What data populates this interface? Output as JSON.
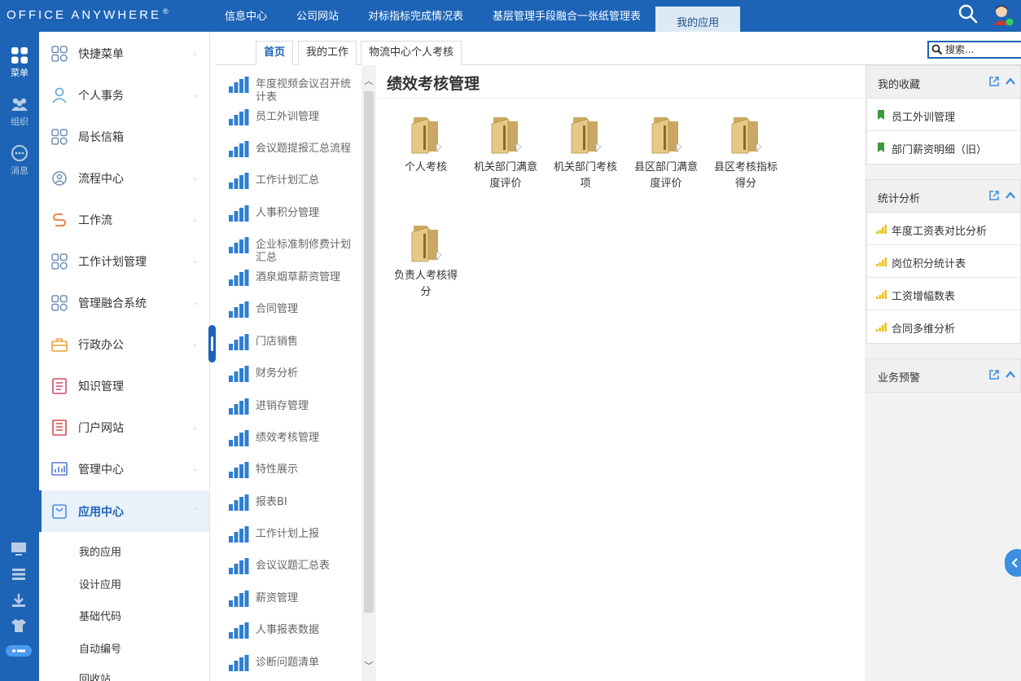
{
  "header": {
    "logo_text": "OFFICE ANYWHERE",
    "logo_mark": "®",
    "tabs": [
      {
        "label": "信息中心"
      },
      {
        "label": "公司网站"
      },
      {
        "label": "对标指标完成情况表"
      },
      {
        "label": "基层管理手段融合一张纸管理表"
      },
      {
        "label": "我的应用"
      }
    ],
    "active_tab": "我的应用",
    "search_icon": "search-icon",
    "avatar_icon": "user-avatar-icon"
  },
  "rail": {
    "items": [
      {
        "label": "菜单",
        "icon": "grid-icon"
      },
      {
        "label": "组织",
        "icon": "people-icon"
      },
      {
        "label": "消息",
        "icon": "chat-icon"
      }
    ],
    "bottom_icons": [
      "monitor-icon",
      "layers-icon",
      "download-icon",
      "shirt-icon",
      "toggle-icon"
    ]
  },
  "menu": {
    "items": [
      {
        "label": "快捷菜单",
        "icon": "apps-icon"
      },
      {
        "label": "个人事务",
        "icon": "person-icon"
      },
      {
        "label": "局长信箱",
        "icon": "apps-icon"
      },
      {
        "label": "流程中心",
        "icon": "flow-icon"
      },
      {
        "label": "工作流",
        "icon": "workflow-icon"
      },
      {
        "label": "工作计划管理",
        "icon": "apps-icon"
      },
      {
        "label": "管理融合系统",
        "icon": "apps-icon"
      },
      {
        "label": "行政办公",
        "icon": "briefcase-icon"
      },
      {
        "label": "知识管理",
        "icon": "book-icon"
      },
      {
        "label": "门户网站",
        "icon": "portal-icon"
      },
      {
        "label": "管理中心",
        "icon": "chart-icon"
      },
      {
        "label": "应用中心",
        "icon": "app-center-icon"
      }
    ],
    "active": "应用中心",
    "sub_items": [
      {
        "label": "我的应用"
      },
      {
        "label": "设计应用"
      },
      {
        "label": "基础代码"
      },
      {
        "label": "自动编号"
      },
      {
        "label": "回收站"
      }
    ]
  },
  "subtabs": [
    {
      "label": "首页"
    },
    {
      "label": "我的工作"
    },
    {
      "label": "物流中心个人考核"
    }
  ],
  "search": {
    "placeholder": "搜索..."
  },
  "apps": [
    {
      "label": "年度视频会议召开统计表"
    },
    {
      "label": "员工外训管理"
    },
    {
      "label": "会议题提报汇总流程"
    },
    {
      "label": "工作计划汇总"
    },
    {
      "label": "人事积分管理"
    },
    {
      "label": "企业标准制修费计划汇总"
    },
    {
      "label": "酒泉烟草薪资管理"
    },
    {
      "label": "合同管理"
    },
    {
      "label": "门店销售"
    },
    {
      "label": "财务分析"
    },
    {
      "label": "进销存管理"
    },
    {
      "label": "绩效考核管理"
    },
    {
      "label": "特性展示"
    },
    {
      "label": "报表BI"
    },
    {
      "label": "工作计划上报"
    },
    {
      "label": "会议议题汇总表"
    },
    {
      "label": "薪资管理"
    },
    {
      "label": "人事报表数据"
    },
    {
      "label": "诊断问题清单"
    }
  ],
  "main": {
    "title": "绩效考核管理",
    "folders": [
      {
        "label": "个人考核"
      },
      {
        "label": "机关部门满意度评价"
      },
      {
        "label": "机关部门考核项"
      },
      {
        "label": "县区部门满意度评价"
      },
      {
        "label": "县区考核指标得分"
      },
      {
        "label": "负责人考核得分"
      }
    ]
  },
  "widgets": {
    "favorites": {
      "title": "我的收藏",
      "items": [
        {
          "label": "员工外训管理"
        },
        {
          "label": "部门薪资明细（旧）"
        }
      ]
    },
    "stats": {
      "title": "统计分析",
      "items": [
        {
          "label": "年度工资表对比分析"
        },
        {
          "label": "岗位积分统计表"
        },
        {
          "label": "工资增幅数表"
        },
        {
          "label": "合同多维分析"
        }
      ]
    },
    "alerts": {
      "title": "业务预警"
    }
  },
  "colors": {
    "brand_blue": "#1d64b6",
    "folder_tan": "#e6c987",
    "bookmark_green": "#3c9a3c",
    "bar_yellow": "#e8c020"
  }
}
